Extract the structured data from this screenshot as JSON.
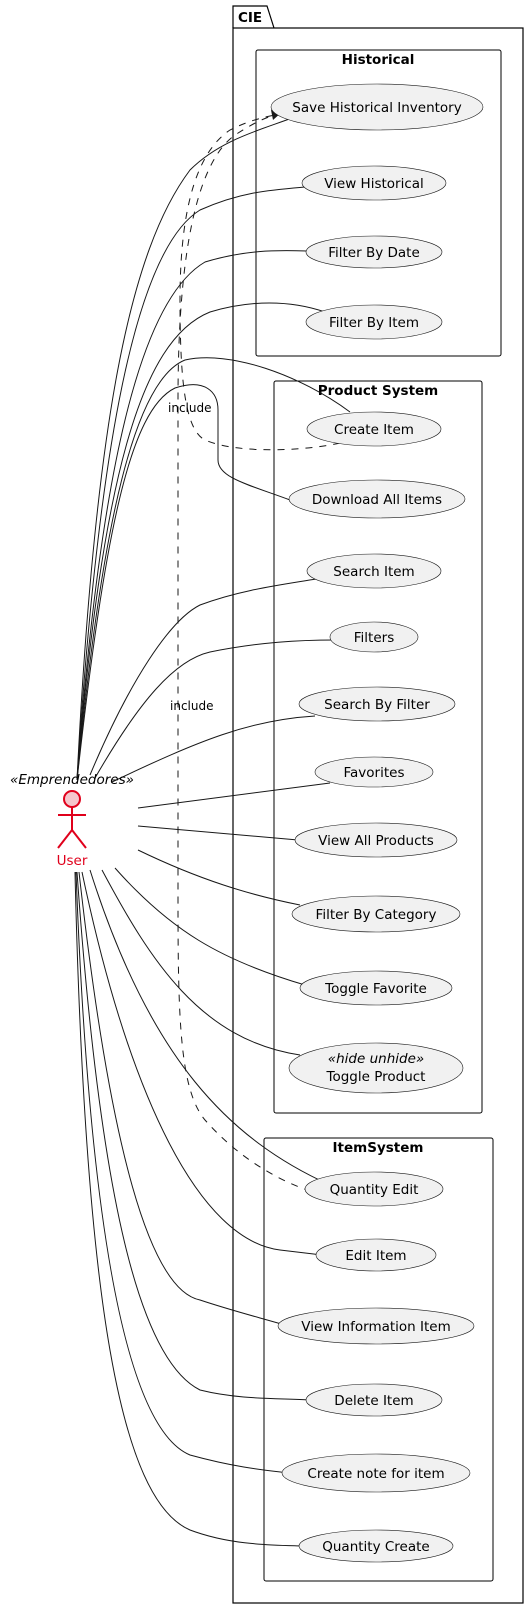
{
  "system": {
    "name": "CIE",
    "packages": [
      {
        "name": "Historical",
        "use_cases": [
          "Save Historical Inventory",
          "View Historical",
          "Filter By Date",
          "Filter By Item"
        ]
      },
      {
        "name": "Product System",
        "use_cases": [
          "Create Item",
          "Download All Items",
          "Search Item",
          "Filters",
          "Search By Filter",
          "Favorites",
          "View All Products",
          "Filter By Category",
          "Toggle Favorite",
          "Toggle Product"
        ]
      },
      {
        "name": "ItemSystem",
        "use_cases": [
          "Quantity Edit",
          "Edit Item",
          "View Information Item",
          "Delete Item",
          "Create note for item",
          "Quantity Create"
        ]
      }
    ]
  },
  "actor": {
    "name": "User",
    "stereotype": "«Emprendedores»"
  },
  "stereotypes": {
    "toggle_product": "«hide unhide»"
  },
  "relations": {
    "include_label_1": "include",
    "include_label_2": "include"
  },
  "colors": {
    "actor": "#e0001b",
    "actor_fill": "#f5c6cc",
    "usecase_fill": "#f1f1f1",
    "line": "#181818"
  }
}
